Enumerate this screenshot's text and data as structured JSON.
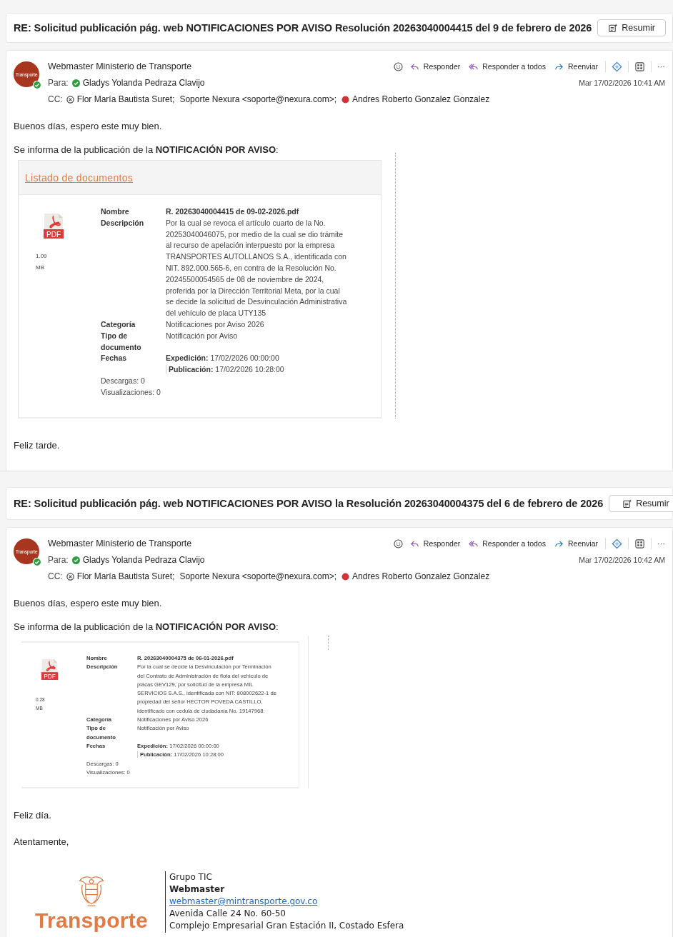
{
  "emails": [
    {
      "subject": "RE: Solicitud publicación pág. web NOTIFICACIONES POR AVISO Resolución 20263040004415 del 9 de febrero de 2026",
      "summarize_button": "Resumir",
      "avatar_label": "Transporte",
      "sender": "Webmaster Ministerio de Transporte",
      "actions": [
        {
          "kind": "emoji"
        },
        {
          "kind": "reply",
          "label": "Responder"
        },
        {
          "kind": "reply_all",
          "label": "Responder a todos"
        },
        {
          "kind": "forward",
          "label": "Reenviar"
        },
        {
          "kind": "loop"
        },
        {
          "kind": "apps"
        },
        {
          "kind": "more",
          "label": "···"
        }
      ],
      "to_label": "Para:",
      "to": [
        {
          "name": "Gladys Yolanda Pedraza Clavijo",
          "kind": "available"
        }
      ],
      "date": "Mar 17/02/2026 10:41 AM",
      "cc_label": "CC:",
      "cc": [
        {
          "name": "Flor María Bautista Suret;",
          "kind": "blocked"
        },
        {
          "name": "Soporte Nexura <soporte@nexura.com>;",
          "kind": "plain"
        },
        {
          "name": "Andres Roberto Gonzalez Gonzalez",
          "kind": "busy"
        }
      ],
      "greeting": "Buenos días, espero este muy bien.",
      "intro": "Se informa de la publicación de la **NOTIFICACIÓN POR AVISO**:",
      "document": {
        "kind": "full",
        "heading": "Listado de documentos",
        "file_type": "PDF",
        "file_size": "1.09",
        "file_unit": "MB",
        "rows": [
          {
            "kind": "bold",
            "label": "Nombre",
            "value": "R. 20263040004415 de 09-02-2026.pdf"
          },
          {
            "kind": "text",
            "label": "Descripción",
            "value": "Por la cual se revoca el artículo cuarto de la No. 20253040046075, por medio de la cual se dio trámite al recurso de apelación interpuesto por la empresa TRANSPORTES AUTOLLANOS S.A., identificada con NIT. 892.000.565-6, en contra de la Resolución No. 20245500054565 de 08 de noviembre de 2024, proferida por la Dirección Territorial Meta, por la cual se decide la solicitud de Desvinculación Administrativa del vehículo de placa UTY135"
          },
          {
            "kind": "text",
            "label": "Categoría",
            "value": "Notificaciones por Aviso 2026"
          },
          {
            "kind": "text",
            "label": "Tipo de documento",
            "value": "Notificación por Aviso"
          },
          {
            "kind": "dates",
            "label": "Fechas",
            "dates": [
              {
                "label": "Expedición:",
                "value": "17/02/2026 00:00:00"
              },
              {
                "label": "Publicación:",
                "value": "17/02/2026 10:28:00"
              }
            ]
          }
        ],
        "counters": [
          "Descargas: 0",
          "Visualizaciones: 0"
        ]
      },
      "closing": "Feliz tarde."
    },
    {
      "subject": "RE: Solicitud publicación pág. web NOTIFICACIONES POR AVISO la Resolución 20263040004375 del 6 de febrero de 2026",
      "summarize_button": "Resumir",
      "avatar_label": "Transporte",
      "sender": "Webmaster Ministerio de Transporte",
      "actions": [
        {
          "kind": "emoji"
        },
        {
          "kind": "reply",
          "label": "Responder"
        },
        {
          "kind": "reply_all",
          "label": "Responder a todos"
        },
        {
          "kind": "forward",
          "label": "Reenviar"
        },
        {
          "kind": "loop"
        },
        {
          "kind": "apps"
        },
        {
          "kind": "more",
          "label": "···"
        }
      ],
      "to_label": "Para:",
      "to": [
        {
          "name": "Gladys Yolanda Pedraza Clavijo",
          "kind": "available"
        }
      ],
      "date": "Mar 17/02/2026 10:42 AM",
      "cc_label": "CC:",
      "cc": [
        {
          "name": "Flor María Bautista Suret;",
          "kind": "blocked"
        },
        {
          "name": "Soporte Nexura <soporte@nexura.com>;",
          "kind": "plain"
        },
        {
          "name": "Andres Roberto Gonzalez Gonzalez",
          "kind": "busy"
        }
      ],
      "greeting": "Buenos días, espero este muy bien.",
      "intro": "Se informa de la publicación de la **NOTIFICACIÓN POR AVISO**:",
      "document": {
        "kind": "compact",
        "file_type": "PDF",
        "file_size": "0.28",
        "file_unit": "MB",
        "rows": [
          {
            "kind": "bold",
            "label": "Nombre",
            "value": "R. 20263040004375 de 06-01-2026.pdf"
          },
          {
            "kind": "text",
            "label": "Descripción",
            "value": "Por la cual se decide la Desvinculación por Terminación del Contrato de Administración de flota del vehiculo de placas GEV129, por solicitud de la empresa MIL SERVICIOS S.A.S., identificada con NIT: 808002622-1 de propiedad del señor HECTOR POVEDA CASTILLO, identificado con cedula de ciudadania No. 19147968."
          },
          {
            "kind": "text",
            "label": "Categoría",
            "value": "Notificaciones por Aviso 2026"
          },
          {
            "kind": "text",
            "label": "Tipo de documento",
            "value": "Notificación por Aviso"
          },
          {
            "kind": "dates",
            "label": "Fechas",
            "dates": [
              {
                "label": "Expedición:",
                "value": "17/02/2026 00:00:00"
              },
              {
                "label": "Publicación:",
                "value": "17/02/2026 10:28:00"
              }
            ]
          }
        ],
        "counters": [
          "Descargas: 0",
          "Visualizaciones: 0"
        ]
      },
      "closing": "Feliz día.",
      "signoff": "Atentamente,",
      "signature": {
        "logo_text": "Transporte",
        "lines": [
          {
            "kind": "text",
            "text": "Grupo TIC"
          },
          {
            "kind": "bold",
            "text": "Webmaster"
          },
          {
            "kind": "link",
            "text": "webmaster@mintransporte.gov.co"
          },
          {
            "kind": "text",
            "text": "Avenida Calle 24 No. 60-50"
          },
          {
            "kind": "text",
            "text": "Complejo Empresarial Gran Estación II, Costado Esfera"
          }
        ]
      }
    }
  ]
}
